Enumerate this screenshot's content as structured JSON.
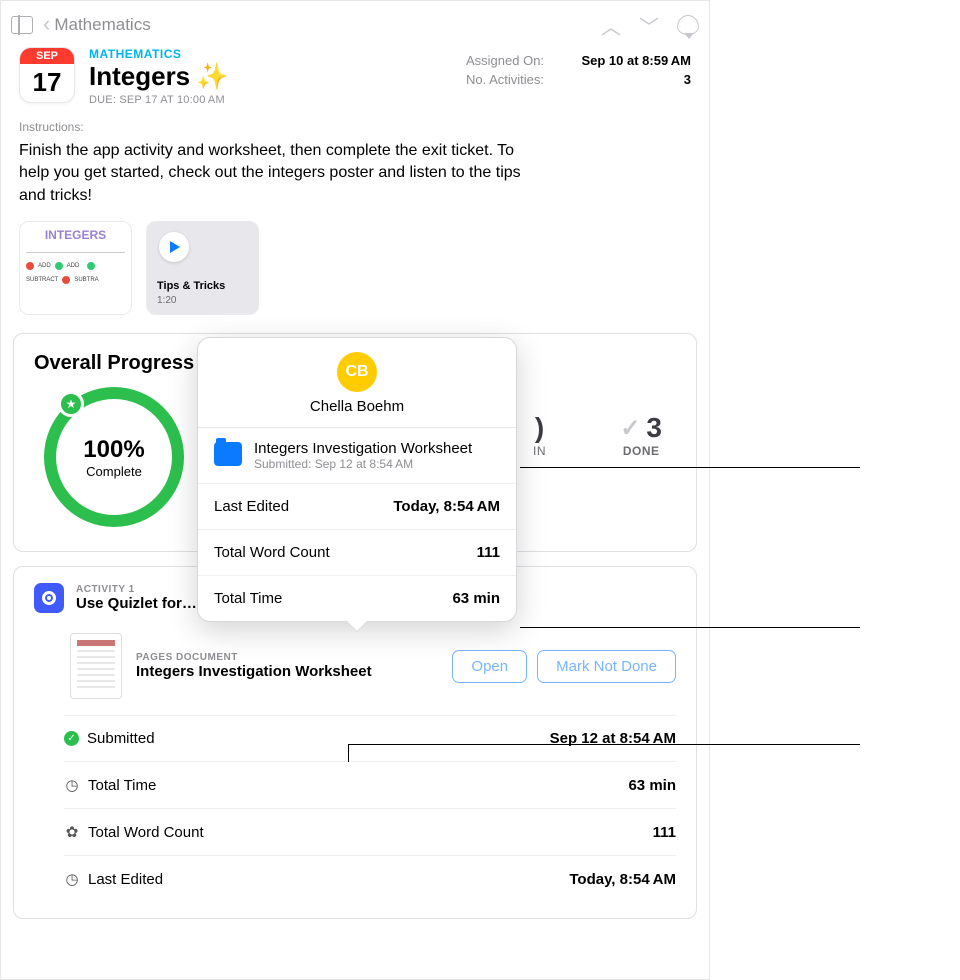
{
  "nav": {
    "back_label": "Mathematics"
  },
  "header": {
    "calendar_month": "SEP",
    "calendar_day": "17",
    "subject": "MATHEMATICS",
    "title": "Integers",
    "due": "DUE: SEP 17 AT 10:00 AM",
    "assigned_label": "Assigned On:",
    "assigned_value": "Sep 10 at 8:59 AM",
    "activities_label": "No. Activities:",
    "activities_value": "3"
  },
  "instructions": {
    "label": "Instructions:",
    "text": "Finish the app activity and worksheet, then complete the exit ticket. To help you get started, check out the integers poster and listen to the tips and tricks!"
  },
  "attachments": {
    "poster_title": "INTEGERS",
    "video_title": "Tips & Tricks",
    "video_duration": "1:20"
  },
  "progress": {
    "section_title": "Overall Progress",
    "percent": "100%",
    "percent_label": "Complete",
    "done_count": "3",
    "done_label": "DONE",
    "other_label_tail": "IN"
  },
  "activity": {
    "eyebrow": "ACTIVITY 1",
    "title": "Use Quizlet for…"
  },
  "document": {
    "eyebrow": "PAGES DOCUMENT",
    "title": "Integers Investigation Worksheet",
    "open_btn": "Open",
    "mark_btn": "Mark Not Done"
  },
  "details": {
    "submitted_label": "Submitted",
    "submitted_value": "Sep 12 at 8:54 AM",
    "total_time_label": "Total Time",
    "total_time_value": "63 min",
    "word_count_label": "Total Word Count",
    "word_count_value": "111",
    "last_edited_label": "Last Edited",
    "last_edited_value": "Today, 8:54 AM"
  },
  "popover": {
    "initials": "CB",
    "name": "Chella Boehm",
    "file_title": "Integers Investigation Worksheet",
    "file_sub": "Submitted: Sep 12 at 8:54 AM",
    "last_edited_label": "Last Edited",
    "last_edited_value": "Today, 8:54 AM",
    "word_count_label": "Total Word Count",
    "word_count_value": "111",
    "total_time_label": "Total Time",
    "total_time_value": "63 min"
  }
}
